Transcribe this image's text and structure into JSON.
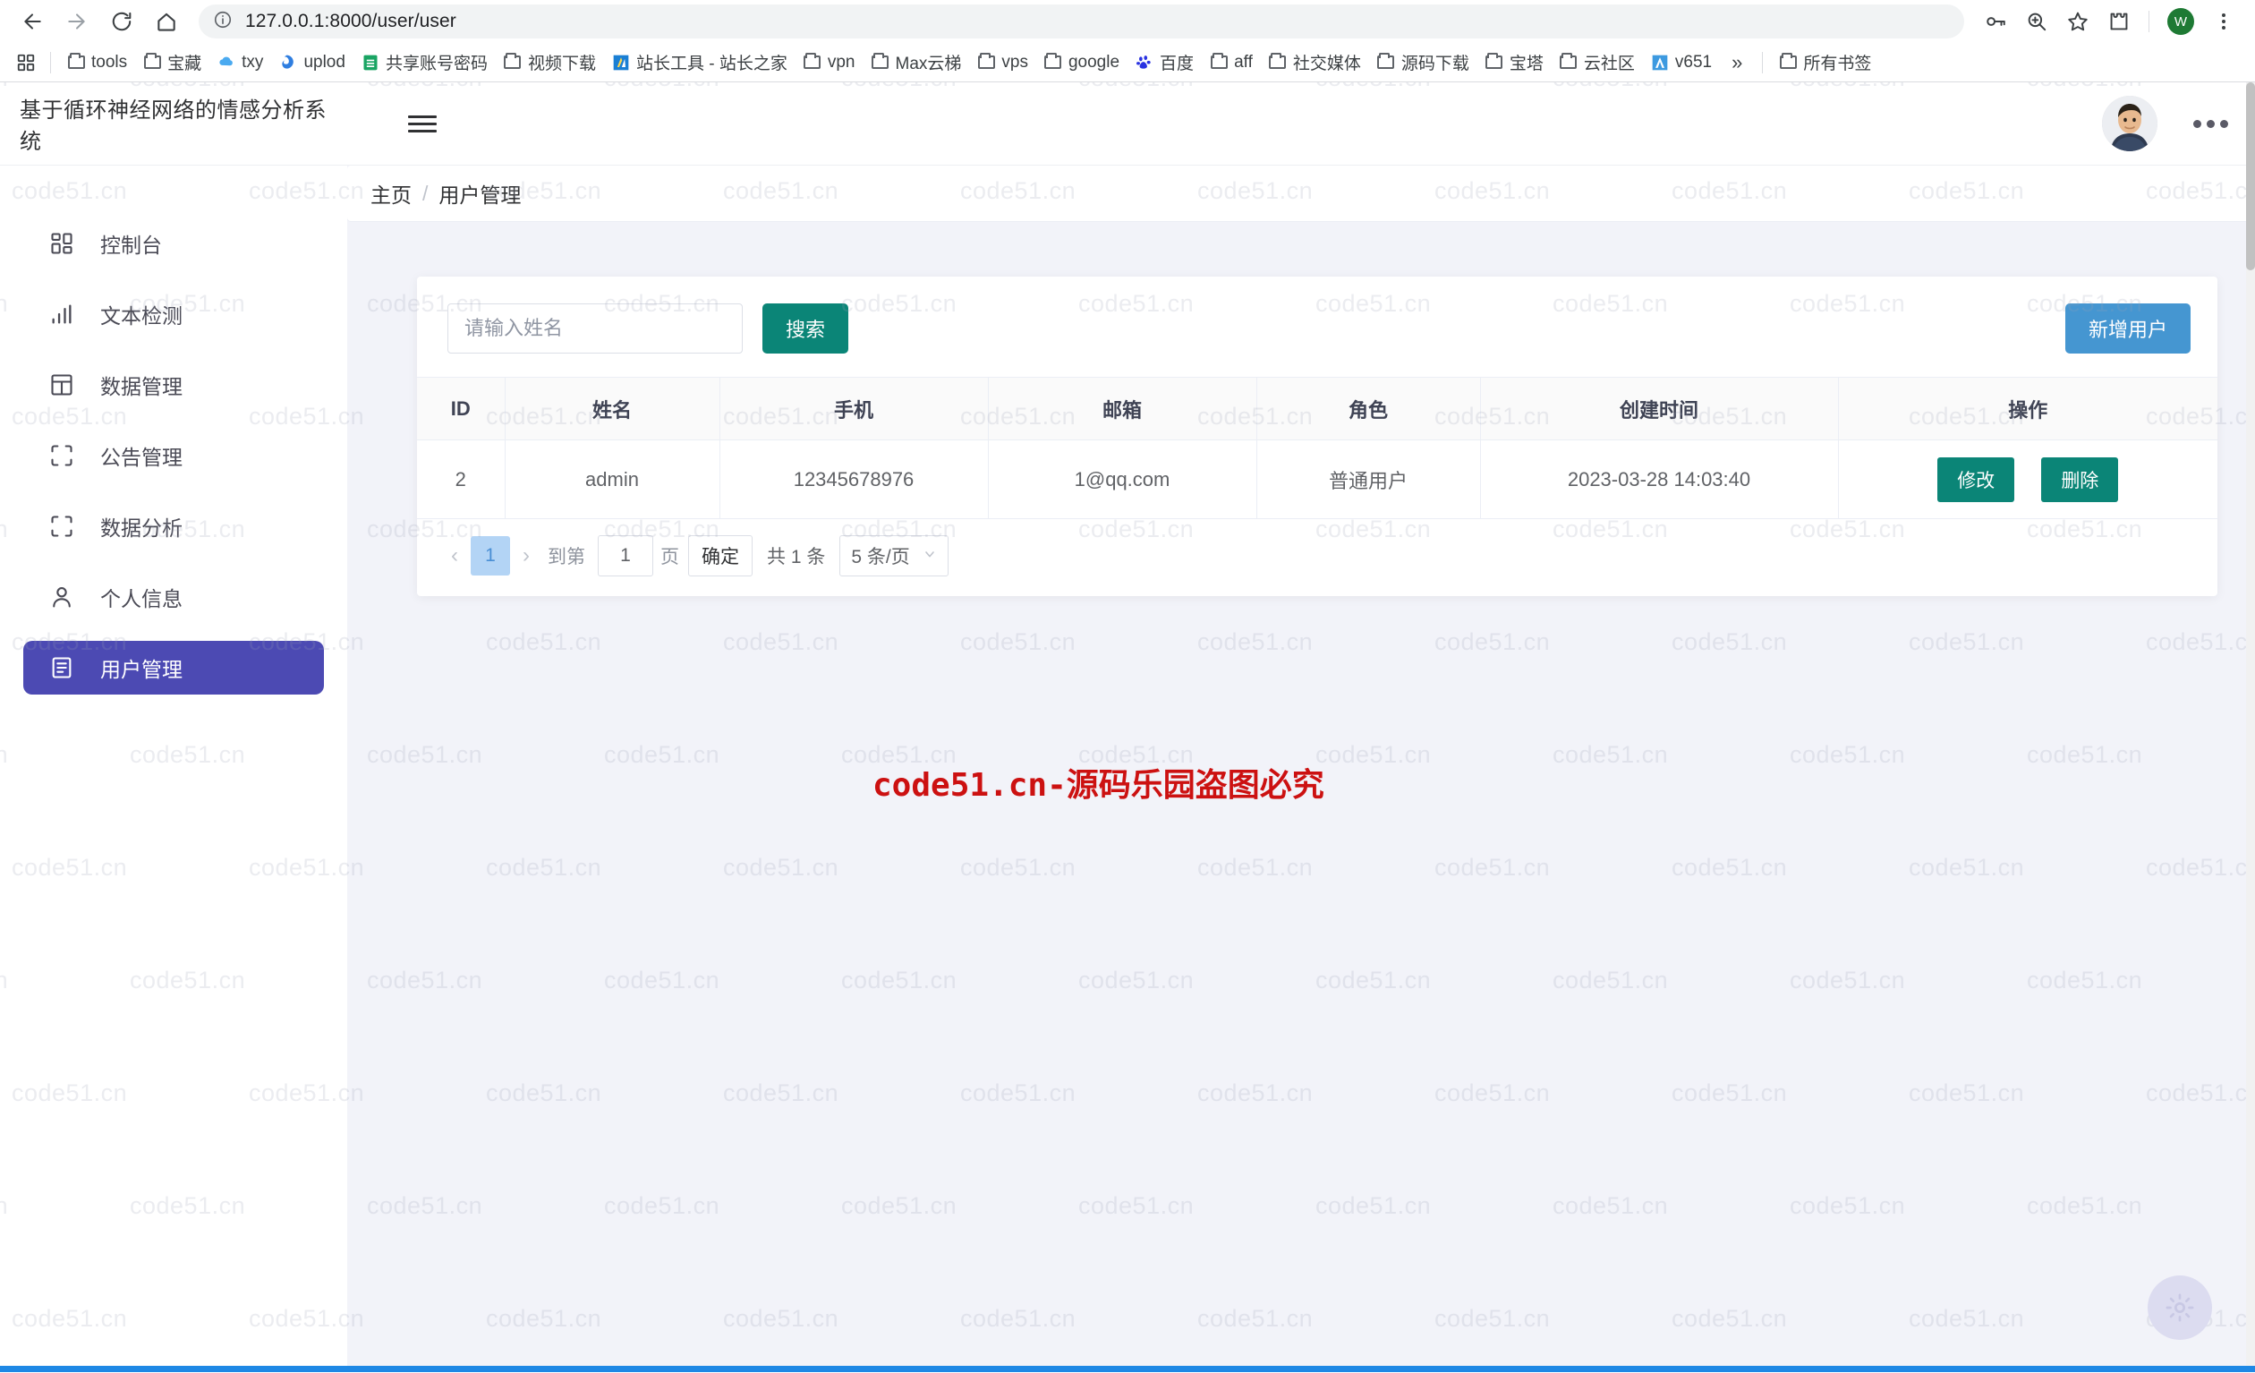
{
  "browser": {
    "url": "127.0.0.1:8000/user/user",
    "nav": {
      "back": "back-arrow",
      "forward": "forward-arrow",
      "reload": "reload",
      "home": "home"
    },
    "toolbar_icons": [
      "password-key-icon",
      "zoom-icon",
      "bookmark-star-icon",
      "extensions-puzzle-icon"
    ],
    "profile_initial": "W",
    "bookmarks": [
      {
        "label": "tools",
        "icon": "folder"
      },
      {
        "label": "宝藏",
        "icon": "folder"
      },
      {
        "label": "txy",
        "icon": "tencent-cloud"
      },
      {
        "label": "uplod",
        "icon": "blue-swirl"
      },
      {
        "label": "共享账号密码",
        "icon": "sheets-green"
      },
      {
        "label": "视频下载",
        "icon": "folder"
      },
      {
        "label": "站长工具 - 站长之家",
        "icon": "chinaz-blue"
      },
      {
        "label": "vpn",
        "icon": "folder"
      },
      {
        "label": "Max云梯",
        "icon": "folder"
      },
      {
        "label": "vps",
        "icon": "folder"
      },
      {
        "label": "google",
        "icon": "folder"
      },
      {
        "label": "百度",
        "icon": "baidu-paw"
      },
      {
        "label": "aff",
        "icon": "folder"
      },
      {
        "label": "社交媒体",
        "icon": "folder"
      },
      {
        "label": "源码下载",
        "icon": "folder"
      },
      {
        "label": "宝塔",
        "icon": "folder"
      },
      {
        "label": "云社区",
        "icon": "folder"
      },
      {
        "label": "v651",
        "icon": "blue-a"
      }
    ],
    "overflow": "»",
    "all_bookmarks": {
      "label": "所有书签",
      "icon": "folder"
    }
  },
  "app": {
    "title": "基于循环神经网络的情感分析系统",
    "menu_toggle": "hamburger-icon",
    "more_icon": "more-dots-icon"
  },
  "sidebar": {
    "items": [
      {
        "label": "控制台",
        "icon": "dashboard-grid-icon",
        "active": false
      },
      {
        "label": "文本检测",
        "icon": "bar-chart-icon",
        "active": false
      },
      {
        "label": "数据管理",
        "icon": "table-grid-icon",
        "active": false
      },
      {
        "label": "公告管理",
        "icon": "corners-icon",
        "active": false
      },
      {
        "label": "数据分析",
        "icon": "corners-icon",
        "active": false
      },
      {
        "label": "个人信息",
        "icon": "person-icon",
        "active": false
      },
      {
        "label": "用户管理",
        "icon": "document-list-icon",
        "active": true
      }
    ]
  },
  "breadcrumb": {
    "home": "主页",
    "separator": "/",
    "current": "用户管理"
  },
  "search": {
    "placeholder": "请输入姓名",
    "value": "",
    "button_label": "搜索"
  },
  "actions": {
    "add_user_label": "新增用户"
  },
  "table": {
    "columns": [
      "ID",
      "姓名",
      "手机",
      "邮箱",
      "角色",
      "创建时间",
      "操作"
    ],
    "rows": [
      {
        "id": "2",
        "name": "admin",
        "phone": "12345678976",
        "email": "1@qq.com",
        "role": "普通用户",
        "created_at": "2023-03-28 14:03:40",
        "edit_label": "修改",
        "delete_label": "删除"
      }
    ]
  },
  "pagination": {
    "prev": "‹",
    "current_page": "1",
    "next": "›",
    "goto_label": "到第",
    "goto_value": "1",
    "page_unit": "页",
    "confirm_label": "确定",
    "total_label": "共 1 条",
    "page_size": "5 条/页",
    "chevron": "⌄"
  },
  "watermark": {
    "tile_text": "code51.cn",
    "notice": "code51.cn-源码乐园盗图必究"
  },
  "colors": {
    "sidebar_active": "#4c4ab3",
    "teal_button": "#0b8577",
    "blue_button": "#4596d1",
    "watermark_red": "#cc1111",
    "page_bg": "#f2f3f9"
  },
  "fab": {
    "icon": "gear-icon"
  }
}
